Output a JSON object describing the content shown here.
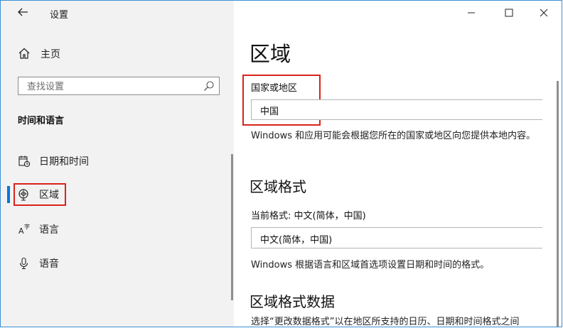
{
  "window": {
    "title": "设置"
  },
  "sidebar": {
    "home_label": "主页",
    "search_placeholder": "查找设置",
    "section_title": "时间和语言",
    "items": [
      {
        "label": "日期和时间",
        "icon": "calendar-clock-icon"
      },
      {
        "label": "区域",
        "icon": "globe-icon",
        "active": true
      },
      {
        "label": "语言",
        "icon": "language-icon"
      },
      {
        "label": "语音",
        "icon": "microphone-icon"
      }
    ]
  },
  "main": {
    "title": "区域",
    "country": {
      "label": "国家或地区",
      "value": "中国",
      "description": "Windows 和应用可能会根据您所在的国家或地区向您提供本地内容。"
    },
    "region_format": {
      "heading": "区域格式",
      "current_label": "当前格式: 中文(简体，中国)",
      "value": "中文(简体，中国)",
      "description": "Windows 根据语言和区域首选项设置日期和时间的格式。"
    },
    "format_data": {
      "heading": "区域格式数据",
      "description": "选择“更改数据格式”以在地区所支持的日历、日期和时间格式之间"
    }
  },
  "colors": {
    "accent": "#0078d7",
    "highlight": "#d9231c",
    "sidebar_bg": "#f2f2f2"
  }
}
